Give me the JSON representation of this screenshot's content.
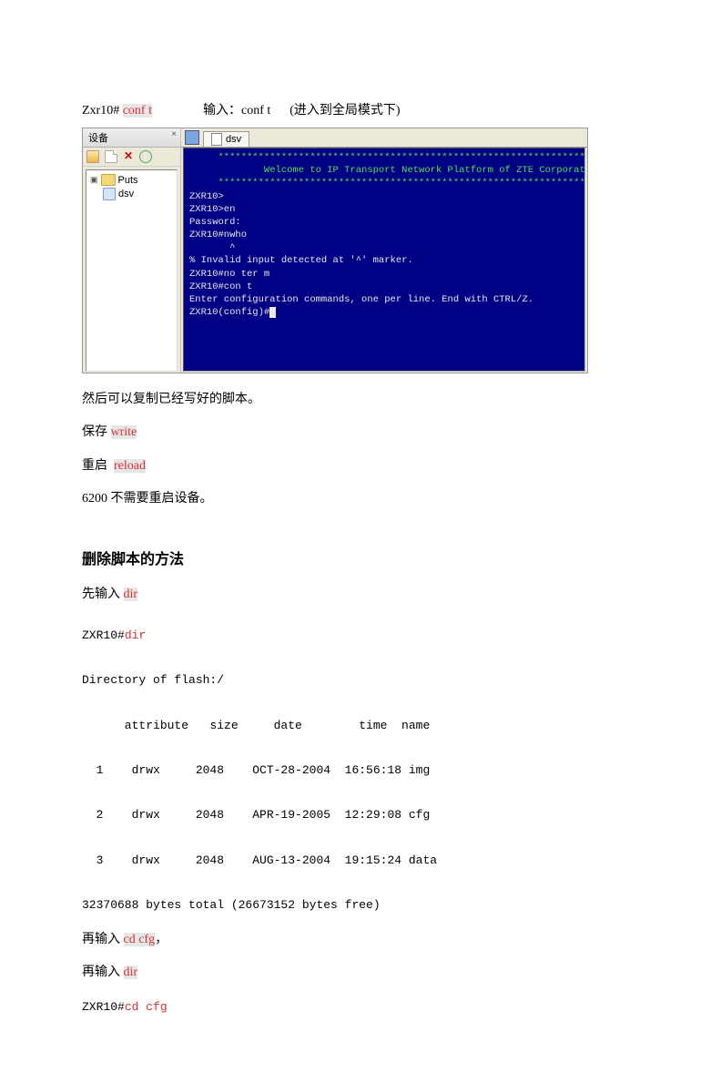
{
  "line1": {
    "prompt": "Zxr10#",
    "cmd": "conf t",
    "label_prefix": "输入：",
    "label_cmd": "conf t",
    "note": "(进入到全局模式下)"
  },
  "screenshot": {
    "side_title": "设备",
    "tree_root": "Puts",
    "tree_child": "dsv",
    "tab_label": "dsv",
    "terminal_lines": [
      "     *****************************************************************",
      "             Welcome to IP Transport Network Platform of ZTE Corporation",
      "     *****************************************************************",
      "ZXR10>",
      "ZXR10>en",
      "Password:",
      "ZXR10#nwho",
      "       ^",
      "% Invalid input detected at '^' marker.",
      "ZXR10#no ter m",
      "ZXR10#con t",
      "Enter configuration commands, one per line. End with CTRL/Z.",
      "ZXR10(config)#"
    ]
  },
  "body": {
    "after_copy": "然后可以复制已经写好的脚本。",
    "save_prefix": "保存",
    "save_cmd": "write",
    "reboot_prefix": "重启",
    "reboot_cmd": "reload",
    "note_6200": "6200 不需要重启设备。",
    "heading_delete": "删除脚本的方法",
    "first_input_prefix": "先输入",
    "first_input_cmd": "dir",
    "dir_block": "ZXR10#dir\n\nDirectory of flash:/\n\n      attribute   size     date        time  name\n\n  1    drwx     2048    OCT-28-2004  16:56:18 img\n\n  2    drwx     2048    APR-19-2005  12:29:08 cfg\n\n  3    drwx     2048    AUG-13-2004  19:15:24 data\n\n32370688 bytes total (26673152 bytes free)",
    "dir_prompt": "ZXR10#",
    "dir_cmd": "dir",
    "dir_rest": "\n\nDirectory of flash:/\n\n      attribute   size     date        time  name\n\n  1    drwx     2048    OCT-28-2004  16:56:18 img\n\n  2    drwx     2048    APR-19-2005  12:29:08 cfg\n\n  3    drwx     2048    AUG-13-2004  19:15:24 data\n\n32370688 bytes total (26673152 bytes free)",
    "then_cd_prefix": "再输入",
    "then_cd_cmd": "cd cfg",
    "then_cd_suffix": "，",
    "then_dir_prefix": "再输入",
    "then_dir_cmd": "dir",
    "last_prompt": "ZXR10#",
    "last_cmd": "cd cfg"
  }
}
